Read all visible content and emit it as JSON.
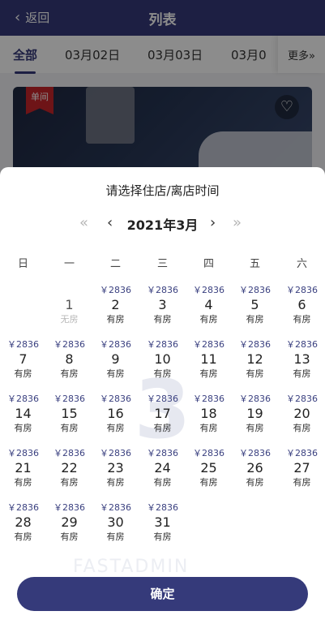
{
  "header": {
    "back_label": "返回",
    "back_icon": "chevron-left",
    "title": "列表"
  },
  "date_tabs": [
    "全部",
    "03月02日",
    "03月03日",
    "03月0"
  ],
  "more_label": "更多»",
  "card": {
    "tag": "单间",
    "heart_icon": "heart-outline"
  },
  "calendar": {
    "title": "请选择住店/离店时间",
    "month_label": "2021年3月",
    "prev_year": "«",
    "prev_month": "‹",
    "next_month": "›",
    "next_year": "»",
    "weekdays": [
      "日",
      "一",
      "二",
      "三",
      "四",
      "五",
      "六"
    ],
    "price_label": "￥2836",
    "available_label": "有房",
    "unavailable_label": "无房",
    "watermark": "3",
    "brand_watermark": "FASTADMIN",
    "days": [
      {
        "day": "1",
        "price": "",
        "status": "无房"
      },
      {
        "day": "2",
        "price": "￥2836",
        "status": "有房"
      },
      {
        "day": "3",
        "price": "￥2836",
        "status": "有房"
      },
      {
        "day": "4",
        "price": "￥2836",
        "status": "有房"
      },
      {
        "day": "5",
        "price": "￥2836",
        "status": "有房"
      },
      {
        "day": "6",
        "price": "￥2836",
        "status": "有房"
      },
      {
        "day": "7",
        "price": "￥2836",
        "status": "有房"
      },
      {
        "day": "8",
        "price": "￥2836",
        "status": "有房"
      },
      {
        "day": "9",
        "price": "￥2836",
        "status": "有房"
      },
      {
        "day": "10",
        "price": "￥2836",
        "status": "有房"
      },
      {
        "day": "11",
        "price": "￥2836",
        "status": "有房"
      },
      {
        "day": "12",
        "price": "￥2836",
        "status": "有房"
      },
      {
        "day": "13",
        "price": "￥2836",
        "status": "有房"
      },
      {
        "day": "14",
        "price": "￥2836",
        "status": "有房"
      },
      {
        "day": "15",
        "price": "￥2836",
        "status": "有房"
      },
      {
        "day": "16",
        "price": "￥2836",
        "status": "有房"
      },
      {
        "day": "17",
        "price": "￥2836",
        "status": "有房"
      },
      {
        "day": "18",
        "price": "￥2836",
        "status": "有房"
      },
      {
        "day": "19",
        "price": "￥2836",
        "status": "有房"
      },
      {
        "day": "20",
        "price": "￥2836",
        "status": "有房"
      },
      {
        "day": "21",
        "price": "￥2836",
        "status": "有房"
      },
      {
        "day": "22",
        "price": "￥2836",
        "status": "有房"
      },
      {
        "day": "23",
        "price": "￥2836",
        "status": "有房"
      },
      {
        "day": "24",
        "price": "￥2836",
        "status": "有房"
      },
      {
        "day": "25",
        "price": "￥2836",
        "status": "有房"
      },
      {
        "day": "26",
        "price": "￥2836",
        "status": "有房"
      },
      {
        "day": "27",
        "price": "￥2836",
        "status": "有房"
      },
      {
        "day": "28",
        "price": "￥2836",
        "status": "有房"
      },
      {
        "day": "29",
        "price": "￥2836",
        "status": "有房"
      },
      {
        "day": "30",
        "price": "￥2836",
        "status": "有房"
      },
      {
        "day": "31",
        "price": "￥2836",
        "status": "有房"
      }
    ],
    "confirm_label": "确定"
  },
  "colors": {
    "primary": "#353a7a",
    "tag_red": "#c8252b",
    "price": "#3b4180"
  }
}
